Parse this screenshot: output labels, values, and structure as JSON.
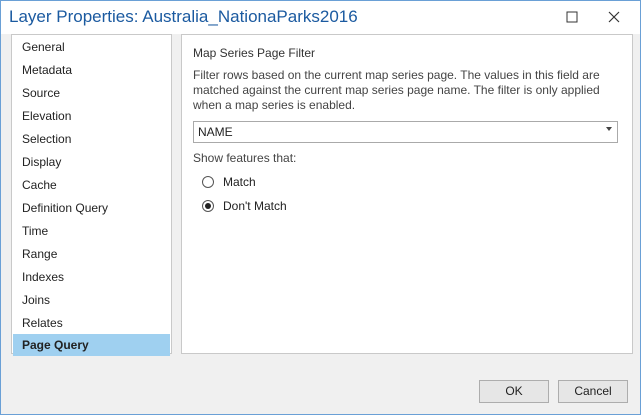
{
  "window": {
    "title": "Layer Properties: Australia_NationaParks2016",
    "maximize_icon": "maximize-icon",
    "close_icon": "close-icon"
  },
  "sidebar": {
    "items": [
      {
        "label": "General"
      },
      {
        "label": "Metadata"
      },
      {
        "label": "Source"
      },
      {
        "label": "Elevation"
      },
      {
        "label": "Selection"
      },
      {
        "label": "Display"
      },
      {
        "label": "Cache"
      },
      {
        "label": "Definition Query"
      },
      {
        "label": "Time"
      },
      {
        "label": "Range"
      },
      {
        "label": "Indexes"
      },
      {
        "label": "Joins"
      },
      {
        "label": "Relates"
      },
      {
        "label": "Page Query"
      }
    ],
    "selected": "Page Query",
    "selected_color": "#9fd0f0"
  },
  "panel": {
    "section_title": "Map Series Page Filter",
    "description": "Filter rows based on the current map series page. The values in this field are matched against the current map series page name. The filter is only applied when a map series is enabled.",
    "field_select": {
      "value": "NAME"
    },
    "show_label": "Show features that:",
    "options": [
      {
        "label": "Match",
        "checked": false
      },
      {
        "label": "Don't Match",
        "checked": true
      }
    ]
  },
  "buttons": {
    "ok": "OK",
    "cancel": "Cancel"
  },
  "colors": {
    "title_text": "#1b5aa0",
    "accent_border": "#6aa0d6"
  }
}
